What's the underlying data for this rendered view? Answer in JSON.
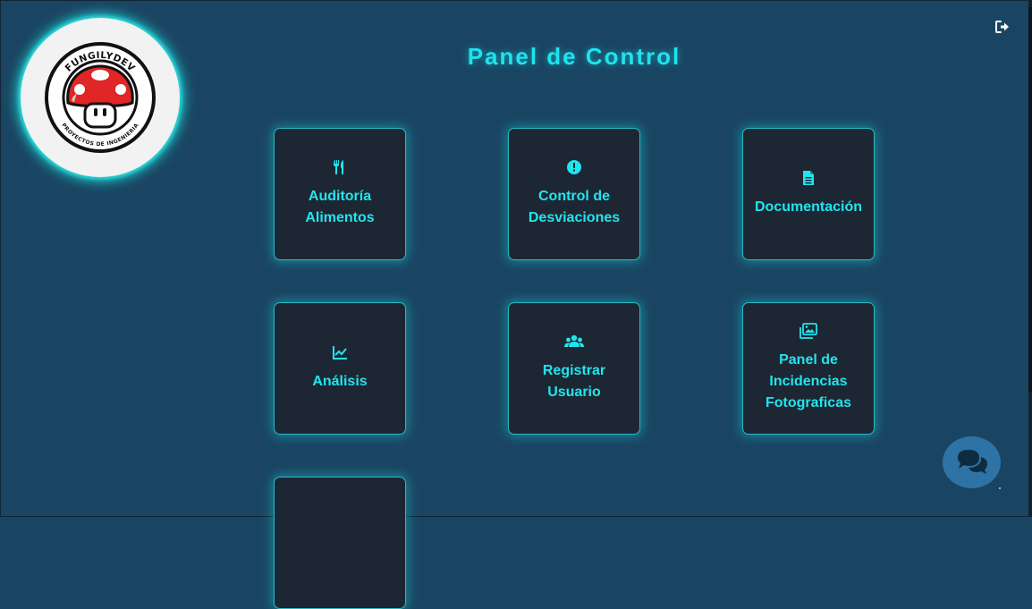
{
  "logo": {
    "top_text": "FUNGILYDEV",
    "bottom_text": "PROYECTOS DE INGENIERIA"
  },
  "page_title": "Panel de Control",
  "header": {
    "logout_icon": "sign-out-icon"
  },
  "cards": [
    {
      "label": "Auditoría Alimentos",
      "icon": "utensils-icon"
    },
    {
      "label": "Control de Desviaciones",
      "icon": "exclamation-circle-icon"
    },
    {
      "label": "Documentación",
      "icon": "file-icon"
    },
    {
      "label": "Análisis",
      "icon": "chart-line-icon"
    },
    {
      "label": "Registrar Usuario",
      "icon": "users-icon"
    },
    {
      "label": "Panel de Incidencias Fotograficas",
      "icon": "images-icon"
    },
    {
      "label": "",
      "icon": ""
    }
  ],
  "chat": {
    "icon": "comments-icon"
  },
  "colors": {
    "background": "#1a4562",
    "accent": "#22e4ee",
    "card": "#1c2733",
    "chat": "#2d73a6"
  }
}
